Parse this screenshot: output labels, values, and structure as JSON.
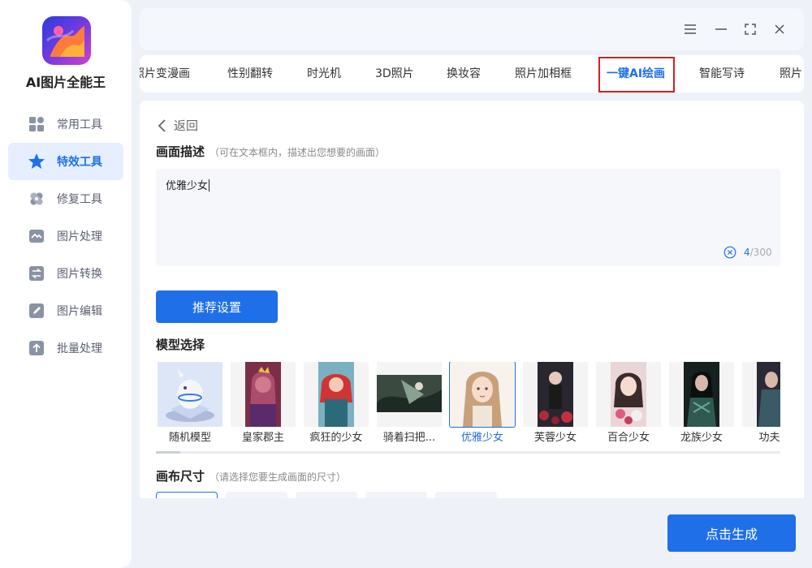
{
  "app": {
    "title": "AI图片全能王"
  },
  "sidebar": {
    "items": [
      {
        "label": "常用工具",
        "icon": "grid-icon",
        "active": false
      },
      {
        "label": "特效工具",
        "icon": "star-icon",
        "active": true
      },
      {
        "label": "修复工具",
        "icon": "bandage-icon",
        "active": false
      },
      {
        "label": "图片处理",
        "icon": "image-wave-icon",
        "active": false
      },
      {
        "label": "图片转换",
        "icon": "convert-icon",
        "active": false
      },
      {
        "label": "图片编辑",
        "icon": "edit-icon",
        "active": false
      },
      {
        "label": "批量处理",
        "icon": "upload-icon",
        "active": false
      }
    ]
  },
  "window_controls": [
    "menu-icon",
    "minimize-icon",
    "maximize-icon",
    "close-icon"
  ],
  "tabs": [
    {
      "label": "照片变漫画",
      "active": false
    },
    {
      "label": "性别翻转",
      "active": false
    },
    {
      "label": "时光机",
      "active": false
    },
    {
      "label": "3D照片",
      "active": false
    },
    {
      "label": "换妆容",
      "active": false
    },
    {
      "label": "照片加相框",
      "active": false
    },
    {
      "label": "一键AI绘画",
      "active": true
    },
    {
      "label": "智能写诗",
      "active": false
    },
    {
      "label": "照片",
      "active": false
    }
  ],
  "main": {
    "back_label": "返回",
    "description": {
      "title": "画面描述",
      "hint": "（可在文本框内，描述出您想要的画面）",
      "value": "优雅少女",
      "count": "4",
      "max": "/300"
    },
    "recommend_label": "推荐设置",
    "model_section": {
      "title": "模型选择",
      "models": [
        {
          "label": "随机模型",
          "selected": false,
          "colors": [
            "#dfe7f7",
            "#b9c9ea"
          ]
        },
        {
          "label": "皇家郡主",
          "selected": false,
          "colors": [
            "#8a3a5a",
            "#c25a7a"
          ]
        },
        {
          "label": "疯狂的少女",
          "selected": false,
          "colors": [
            "#c83a3a",
            "#3a8aa0"
          ]
        },
        {
          "label": "骑着扫把...",
          "selected": false,
          "colors": [
            "#2a3a30",
            "#6a8a70"
          ]
        },
        {
          "label": "优雅少女",
          "selected": true,
          "colors": [
            "#d8b89a",
            "#f3e2d2"
          ]
        },
        {
          "label": "芙蓉少女",
          "selected": false,
          "colors": [
            "#2a2430",
            "#a03040"
          ]
        },
        {
          "label": "百合少女",
          "selected": false,
          "colors": [
            "#e8c8c8",
            "#c04060"
          ]
        },
        {
          "label": "龙族少女",
          "selected": false,
          "colors": [
            "#1a2a2a",
            "#3a6a60"
          ]
        },
        {
          "label": "功夫女",
          "selected": false,
          "colors": [
            "#2a2a3a",
            "#4a6a70"
          ]
        }
      ]
    },
    "canvas_section": {
      "title": "画布尺寸",
      "hint": "（请选择您要生成画面的尺寸）"
    }
  },
  "generate_label": "点击生成",
  "colors": {
    "accent": "#1f6fe8",
    "highlight_border": "#d42020"
  }
}
